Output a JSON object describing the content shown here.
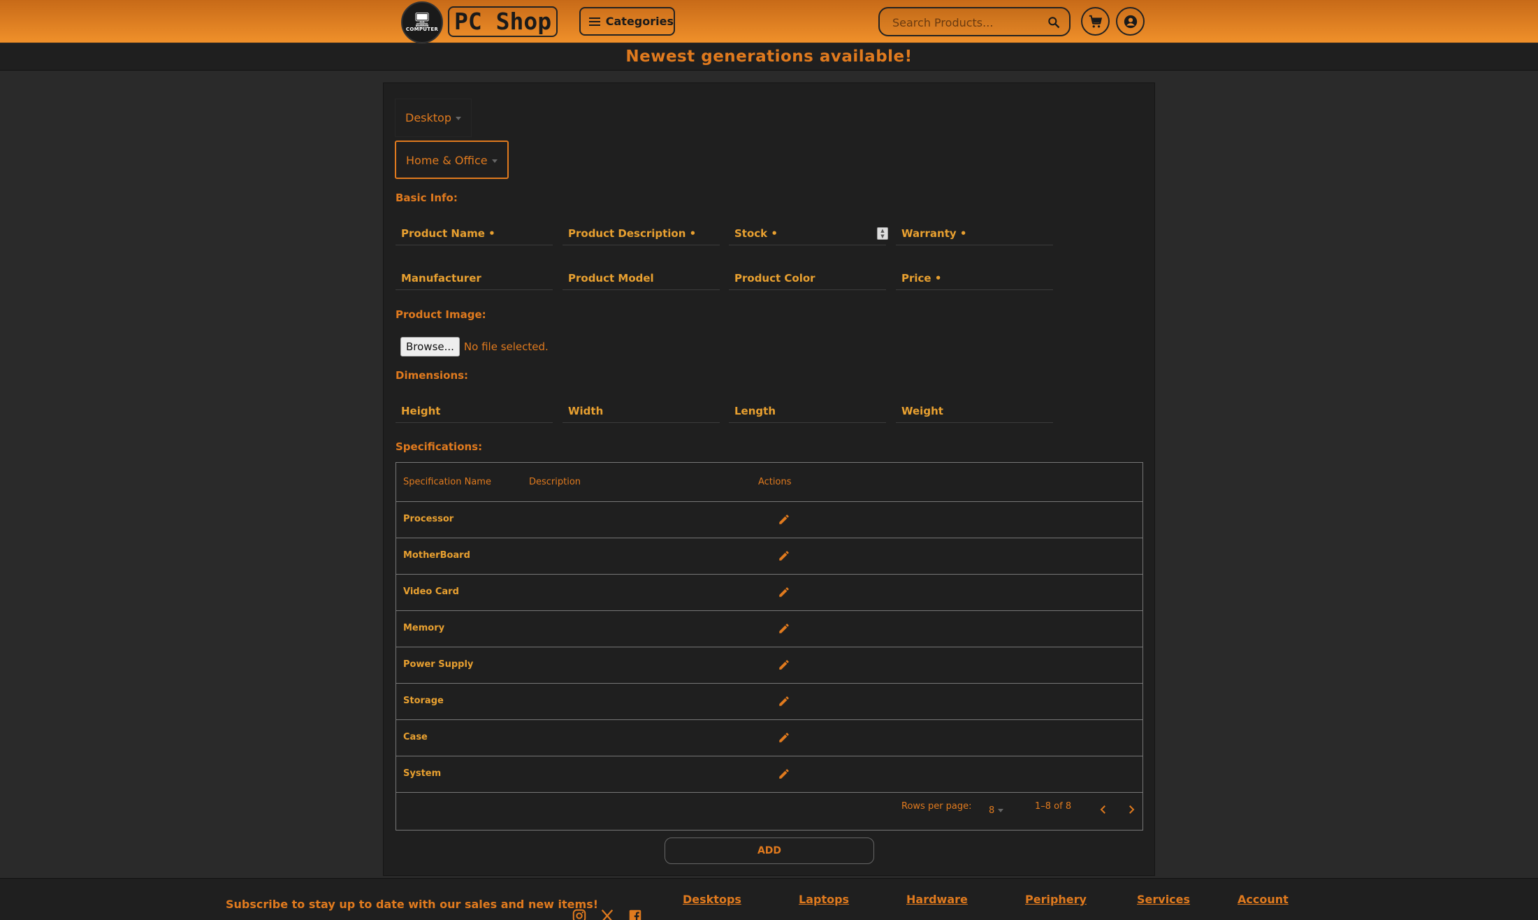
{
  "header": {
    "logo_caption": "COMPUTER",
    "brand": "PC Shop",
    "categories_label": "Categories",
    "search_placeholder": "Search Products..."
  },
  "banner": "Newest generations available!",
  "form": {
    "category": "Desktop",
    "subcategory": "Home & Office",
    "basic_info_label": "Basic Info:",
    "fields": {
      "product_name": "Product Name",
      "product_description": "Product Description",
      "stock": "Stock",
      "warranty": "Warranty",
      "manufacturer": "Manufacturer",
      "product_model": "Product Model",
      "product_color": "Product Color",
      "price": "Price"
    },
    "required_marker": "•",
    "product_image_label": "Product Image:",
    "browse_label": "Browse...",
    "no_file_text": "No file selected.",
    "dimensions_label": "Dimensions:",
    "dimensions": {
      "height": "Height",
      "width": "Width",
      "length": "Length",
      "weight": "Weight"
    },
    "specifications_label": "Specifications:"
  },
  "spec_table": {
    "columns": [
      "Specification Name",
      "Description",
      "Actions"
    ],
    "rows": [
      {
        "name": "Processor",
        "description": ""
      },
      {
        "name": "MotherBoard",
        "description": ""
      },
      {
        "name": "Video Card",
        "description": ""
      },
      {
        "name": "Memory",
        "description": ""
      },
      {
        "name": "Power Supply",
        "description": ""
      },
      {
        "name": "Storage",
        "description": ""
      },
      {
        "name": "Case",
        "description": ""
      },
      {
        "name": "System",
        "description": ""
      }
    ],
    "rows_per_page_label": "Rows per page:",
    "rows_per_page": "8",
    "range": "1–8 of 8"
  },
  "add_label": "ADD",
  "footer": {
    "subscribe": "Subscribe to stay up to date with our sales and new items!",
    "links": [
      "Desktops",
      "Laptops",
      "Hardware",
      "Periphery",
      "Services",
      "Account"
    ]
  },
  "icons": {
    "menu": "hamburger-icon",
    "search": "search-icon",
    "cart": "cart-icon",
    "account": "account-icon",
    "edit": "pencil-icon",
    "prev": "chevron-left-icon",
    "next": "chevron-right-icon",
    "instagram": "instagram-icon",
    "x": "x-icon",
    "facebook": "facebook-icon"
  },
  "colors": {
    "accent": "#e07a1e",
    "label": "#e8a030",
    "header_gradient_top": "#c76a18",
    "header_gradient_bottom": "#f0902a",
    "panel_bg": "#1f1f1f",
    "page_bg": "#2a2a2a"
  }
}
